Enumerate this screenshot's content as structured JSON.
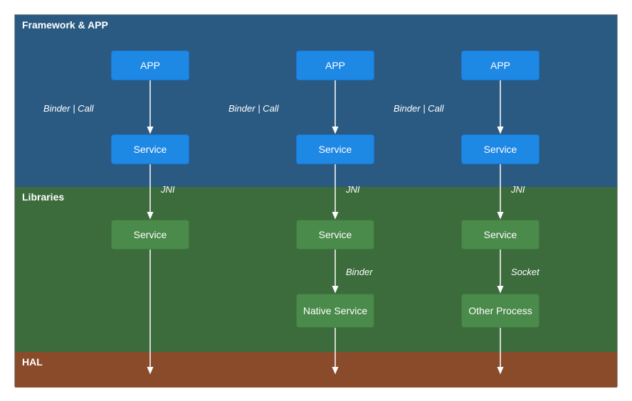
{
  "layers": {
    "framework": "Framework & APP",
    "libraries": "Libraries",
    "hal": "HAL"
  },
  "columns": [
    {
      "app": "APP",
      "service_fw": "Service",
      "service_lib": "Service",
      "edge_app_service": "Binder | Call",
      "edge_service_lib": "JNI",
      "edge_lib_bottom": null,
      "bottom_node": null
    },
    {
      "app": "APP",
      "service_fw": "Service",
      "service_lib": "Service",
      "edge_app_service": "Binder | Call",
      "edge_service_lib": "JNI",
      "edge_lib_bottom": "Binder",
      "bottom_node": "Native Service"
    },
    {
      "app": "APP",
      "service_fw": "Service",
      "service_lib": "Service",
      "edge_app_service": "Binder | Call",
      "edge_service_lib": "JNI",
      "edge_lib_bottom": "Socket",
      "bottom_node": "Other Process"
    }
  ]
}
